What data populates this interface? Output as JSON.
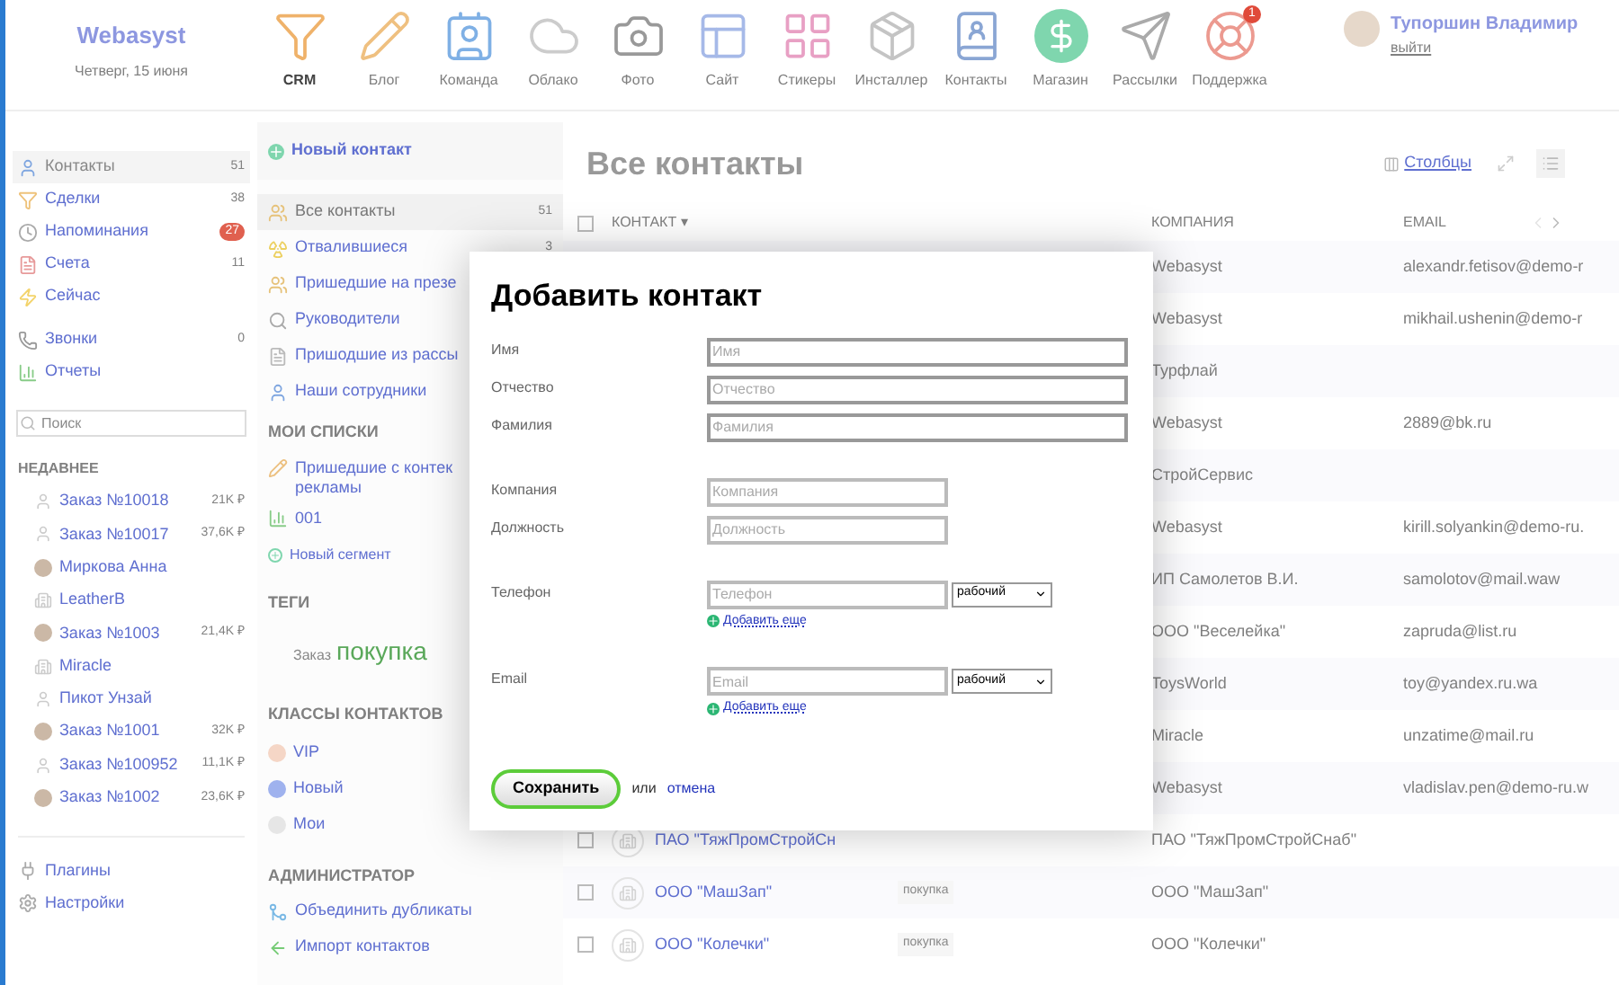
{
  "header": {
    "logo": "Webasyst",
    "date": "Четверг, 15 июня",
    "apps": [
      {
        "label": "CRM",
        "kind": "funnel",
        "selected": true
      },
      {
        "label": "Блог",
        "kind": "pencil",
        "selected": false
      },
      {
        "label": "Команда",
        "kind": "team",
        "selected": false
      },
      {
        "label": "Облако",
        "kind": "cloud",
        "selected": false
      },
      {
        "label": "Фото",
        "kind": "camera",
        "selected": false
      },
      {
        "label": "Сайт",
        "kind": "site",
        "selected": false
      },
      {
        "label": "Стикеры",
        "kind": "stickers",
        "selected": false
      },
      {
        "label": "Инсталлер",
        "kind": "installer",
        "selected": false
      },
      {
        "label": "Контакты",
        "kind": "contacts",
        "selected": false
      },
      {
        "label": "Магазин",
        "kind": "shop",
        "selected": false
      },
      {
        "label": "Рассылки",
        "kind": "mailer",
        "selected": false
      },
      {
        "label": "Поддержка",
        "kind": "support",
        "selected": false,
        "badge": "1"
      }
    ],
    "user": {
      "name": "Тупоршин Владимир",
      "logout": "выйти"
    }
  },
  "sidebar": {
    "items": [
      {
        "label": "Контакты",
        "kind": "user",
        "count": "51",
        "alert": false,
        "selected": true
      },
      {
        "label": "Сделки",
        "kind": "funnel",
        "count": "38",
        "alert": false,
        "selected": false
      },
      {
        "label": "Напоминания",
        "kind": "clock",
        "count": "27",
        "alert": true,
        "selected": false
      },
      {
        "label": "Счета",
        "kind": "invoice",
        "count": "11",
        "alert": false,
        "selected": false
      },
      {
        "label": "Сейчас",
        "kind": "bolt",
        "selected": false
      }
    ],
    "items_2": [
      {
        "label": "Звонки",
        "kind": "phone",
        "count": "0",
        "alert": false,
        "selected": false
      },
      {
        "label": "Отчеты",
        "kind": "chart",
        "selected": false
      }
    ],
    "search": {
      "placeholder": "Поиск"
    },
    "recent_title": "НЕДАВНЕЕ",
    "recent": [
      {
        "label": "Заказ №10018",
        "amount": "21K ₽",
        "kind": "person"
      },
      {
        "label": "Заказ №10017",
        "amount": "37,6K ₽",
        "kind": "person"
      },
      {
        "label": "Миркова Анна",
        "kind": "photo"
      },
      {
        "label": "LeatherB",
        "kind": "company"
      },
      {
        "label": "Заказ №1003",
        "amount": "21,4K ₽",
        "kind": "photo"
      },
      {
        "label": "Miracle",
        "kind": "company"
      },
      {
        "label": "Пикот Унзай",
        "kind": "person"
      },
      {
        "label": "Заказ №1001",
        "amount": "32K ₽",
        "kind": "photo"
      },
      {
        "label": "Заказ №100952",
        "amount": "11,1K ₽",
        "kind": "person"
      },
      {
        "label": "Заказ №1002",
        "amount": "23,6K ₽",
        "kind": "photo"
      }
    ],
    "footer_items": [
      {
        "label": "Плагины",
        "kind": "plug"
      },
      {
        "label": "Настройки",
        "kind": "gear"
      }
    ]
  },
  "lists_panel": {
    "new_contact": "Новый контакт",
    "items": [
      {
        "label": "Все контакты",
        "kind": "users",
        "count": "51",
        "selected": true
      },
      {
        "label": "Отвалившиеся",
        "kind": "hazard",
        "count": "3",
        "selected": false
      },
      {
        "label": "Пришедшие на презе",
        "kind": "users",
        "selected": false
      },
      {
        "label": "Руководители",
        "kind": "search",
        "selected": false
      },
      {
        "label": "Пришодшие из рассы",
        "kind": "file",
        "selected": false
      },
      {
        "label": "Наши сотрудники",
        "kind": "user",
        "selected": false
      }
    ],
    "my_lists_title": "МОИ СПИСКИ",
    "my_lists": [
      {
        "label": "Пришедшие с контек",
        "label_line_2": "рекламы",
        "kind": "pencil"
      },
      {
        "label": "001",
        "kind": "chart"
      }
    ],
    "new_segment": "Новый сегмент",
    "tags_title": "ТЕГИ",
    "tags": [
      {
        "label": "Заказ",
        "kind": "small"
      },
      {
        "label": "покупка",
        "kind": "large"
      }
    ],
    "classes_title": "КЛАССЫ КОНТАКТОВ",
    "classes": [
      {
        "label": "VIP",
        "color": "#f5d6c6"
      },
      {
        "label": "Новый",
        "color": "#9fb2ee"
      },
      {
        "label": "Мои",
        "color": "#e6e6e6"
      }
    ],
    "admin_title": "АДМИНИСТРАТОР",
    "admin": [
      {
        "label": "Объединить дубликаты",
        "kind": "merge"
      },
      {
        "label": "Импорт контактов",
        "kind": "import"
      }
    ]
  },
  "contacts": {
    "title": "Все контакты",
    "columns_link": "Столбцы",
    "select_all_checked": false,
    "columns": [
      {
        "label": "КОНТАКТ",
        "sort_mark": "▾"
      },
      {
        "label": "КОМПАНИЯ"
      },
      {
        "label": "EMAIL"
      }
    ],
    "rows": [
      {
        "company": "Webasyst",
        "email": "alexandr.fetisov@demo-r"
      },
      {
        "company": "Webasyst",
        "email": "mikhail.ushenin@demo-r"
      },
      {
        "company": "Турфлай"
      },
      {
        "company": "Webasyst",
        "email": "2889@bk.ru"
      },
      {
        "company": "СтройСервис"
      },
      {
        "company": "Webasyst",
        "email": "kirill.solyankin@demo-ru."
      },
      {
        "company": "ИП Самолетов В.И.",
        "email": "samolotov@mail.waw"
      },
      {
        "company": "ООО \"Веселейка\"",
        "email": "zapruda@list.ru"
      },
      {
        "company": "ToysWorld",
        "email": "toy@yandex.ru.wa"
      },
      {
        "company": "Miracle",
        "email": "unzatime@mail.ru"
      },
      {
        "company": "Webasyst",
        "email": "vladislav.pen@demo-ru.w"
      },
      {
        "name": "ПАО \"ТяжПромСтройСн",
        "checked": false,
        "company": "ПАО \"ТяжПромСтройСнаб\""
      },
      {
        "name": "ООО \"МашЗап\"",
        "checked": false,
        "tag": "покупка",
        "company": "ООО \"МашЗап\""
      },
      {
        "name": "ООО \"Колечки\"",
        "checked": false,
        "tag": "покупка",
        "company": "ООО \"Колечки\""
      }
    ]
  },
  "dialog": {
    "title": "Добавить контакт",
    "groups": [
      [
        {
          "label": "Имя",
          "placeholder": "Имя",
          "kind": "wide"
        },
        {
          "label": "Отчество",
          "placeholder": "Отчество",
          "kind": "wide"
        },
        {
          "label": "Фамилия",
          "placeholder": "Фамилия",
          "kind": "wide"
        }
      ],
      [
        {
          "label": "Компания",
          "placeholder": "Компания",
          "kind": "narrow"
        },
        {
          "label": "Должность",
          "placeholder": "Должность",
          "kind": "narrow"
        }
      ],
      [
        {
          "label": "Телефон",
          "placeholder": "Телефон",
          "kind": "multi",
          "select": "рабочий",
          "add_more": "Добавить еще"
        }
      ],
      [
        {
          "label": "Email",
          "placeholder": "Email",
          "kind": "multi",
          "select": "рабочий",
          "add_more": "Добавить еще"
        }
      ]
    ],
    "save": "Сохранить",
    "or": "или",
    "cancel": "отмена"
  }
}
